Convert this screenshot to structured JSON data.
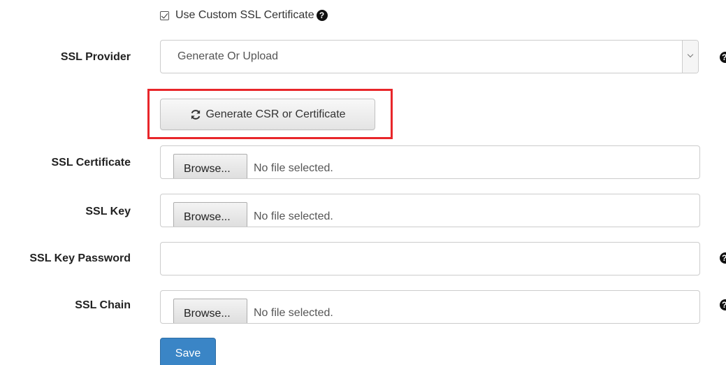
{
  "custom_ssl": {
    "label": "Use Custom SSL Certificate",
    "checked": true,
    "help_icon": "question-circle-icon"
  },
  "ssl_provider": {
    "label": "SSL Provider",
    "selected": "Generate Or Upload",
    "help_icon": "question-circle-icon"
  },
  "generate_button": {
    "label": "Generate CSR or Certificate",
    "icon": "refresh-icon",
    "highlight_color": "#e8262a"
  },
  "ssl_certificate": {
    "label": "SSL Certificate",
    "browse_label": "Browse...",
    "status": "No file selected."
  },
  "ssl_key": {
    "label": "SSL Key",
    "browse_label": "Browse...",
    "status": "No file selected."
  },
  "ssl_key_password": {
    "label": "SSL Key Password",
    "value": "",
    "help_icon": "question-circle-icon"
  },
  "ssl_chain": {
    "label": "SSL Chain",
    "browse_label": "Browse...",
    "status": "No file selected.",
    "help_icon": "question-circle-icon"
  },
  "save_button": {
    "label": "Save",
    "color": "#3a85c6"
  }
}
